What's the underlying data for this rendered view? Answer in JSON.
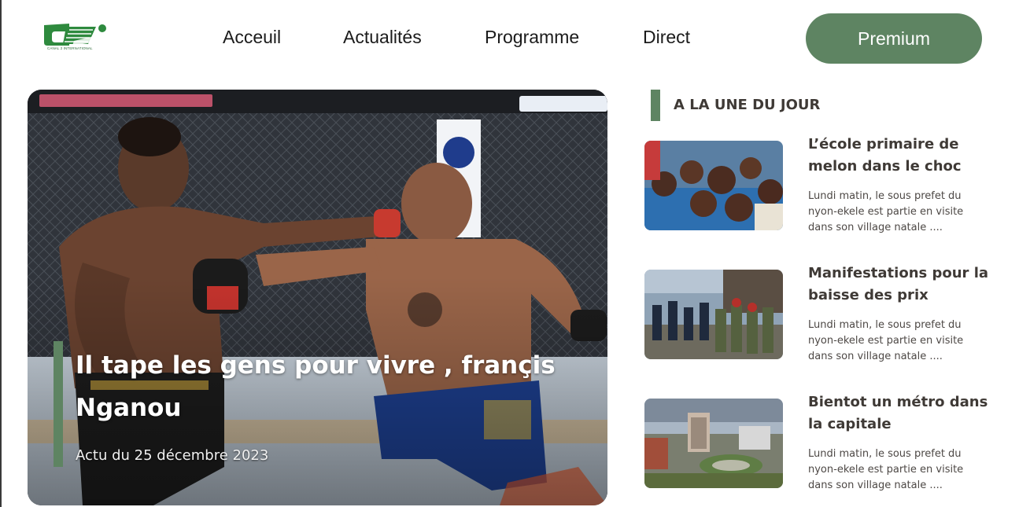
{
  "header": {
    "logo_tagline": "CANAL 2 INTERNATIONAL",
    "nav": [
      "Acceuil",
      "Actualités",
      "Programme",
      "Direct"
    ],
    "premium_label": "Premium"
  },
  "hero": {
    "title": "Il tape les gens pour vivre , françis Nganou",
    "date": "Actu du 25 décembre 2023"
  },
  "sidebar": {
    "heading": "A LA UNE DU JOUR",
    "cards": [
      {
        "title": "L’école primaire de melon dans le choc",
        "description": "Lundi matin, le sous prefet du nyon-ekele est partie en visite dans son village natale ...."
      },
      {
        "title": "Manifestations pour la baisse des prix",
        "description": "Lundi matin, le sous prefet du nyon-ekele est partie en visite dans son village natale ...."
      },
      {
        "title": "Bientot un métro dans la capitale",
        "description": "Lundi matin, le sous prefet du nyon-ekele est partie en visite dans son village natale ...."
      }
    ]
  },
  "colors": {
    "accent": "#5e8462",
    "text_dark": "#3f3a36",
    "logo_green": "#2e8a3e"
  }
}
